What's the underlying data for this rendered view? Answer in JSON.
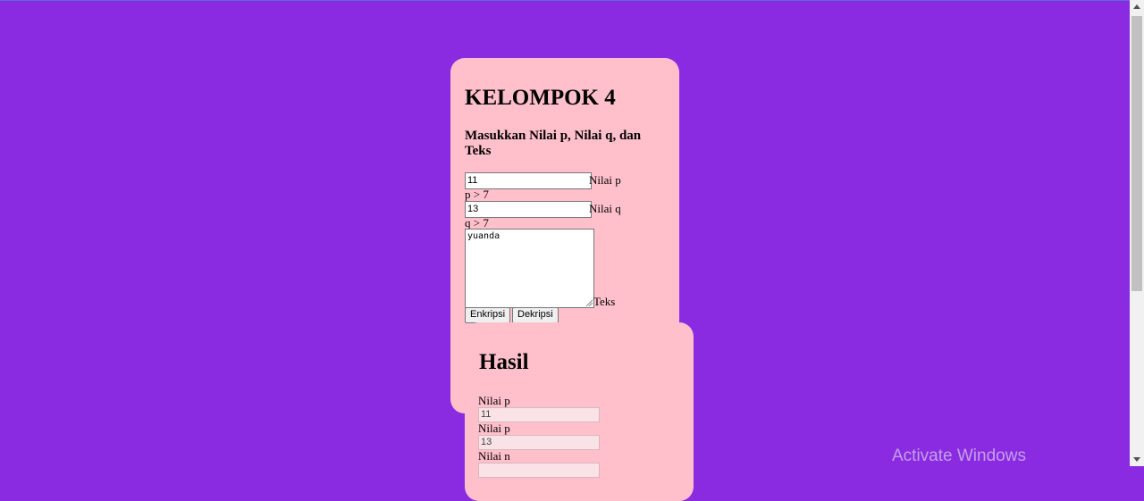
{
  "form": {
    "title": "KELOMPOK 4",
    "subtitle": "Masukkan Nilai p, Nilai q, dan Teks",
    "p_value": "11",
    "p_label": "Nilai p",
    "p_hint": "p > 7",
    "q_value": "13",
    "q_label": "Nilai q",
    "q_hint": "q > 7",
    "text_value": "yuanda",
    "text_label": "Teks",
    "encrypt_label": "Enkripsi",
    "decrypt_label": "Dekripsi"
  },
  "result": {
    "title": "Hasil",
    "fields": [
      {
        "label": "Nilai p",
        "value": "11"
      },
      {
        "label": "Nilai p",
        "value": "13"
      },
      {
        "label": "Nilai n",
        "value": ""
      }
    ]
  },
  "watermark": "Activate Windows",
  "colors": {
    "background": "#8a2be2",
    "card": "#ffc0cb"
  }
}
